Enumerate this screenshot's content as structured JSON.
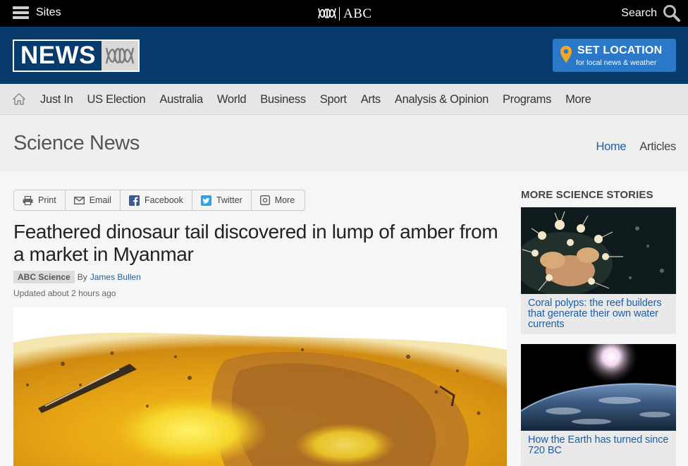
{
  "topbar": {
    "sites_label": "Sites",
    "abc_text": "ABC",
    "search_label": "Search"
  },
  "masthead": {
    "news_word": "NEWS",
    "set_location_title": "SET LOCATION",
    "set_location_sub": "for local news & weather"
  },
  "nav": {
    "items": [
      "Just In",
      "US Election",
      "Australia",
      "World",
      "Business",
      "Sport",
      "Arts",
      "Analysis & Opinion",
      "Programs",
      "More"
    ]
  },
  "section": {
    "title": "Science News",
    "links": [
      "Home",
      "Articles"
    ]
  },
  "share": {
    "print": "Print",
    "email": "Email",
    "facebook": "Facebook",
    "twitter": "Twitter",
    "more": "More"
  },
  "article": {
    "headline": "Feathered dinosaur tail discovered in lump of amber from a market in Myanmar",
    "tag": "ABC Science",
    "by": "By",
    "author": "James Bullen",
    "updated": "Updated about 2 hours ago"
  },
  "sidebar": {
    "heading": "MORE SCIENCE STORIES",
    "stories": [
      {
        "title": "Coral polyps: the reef builders that generate their own water currents"
      },
      {
        "title": "How the Earth has turned since 720 BC"
      }
    ]
  },
  "colors": {
    "masthead": "#063b6b",
    "location_button": "#2a78c7",
    "link": "#1d5eaa",
    "topbar": "#000000"
  }
}
